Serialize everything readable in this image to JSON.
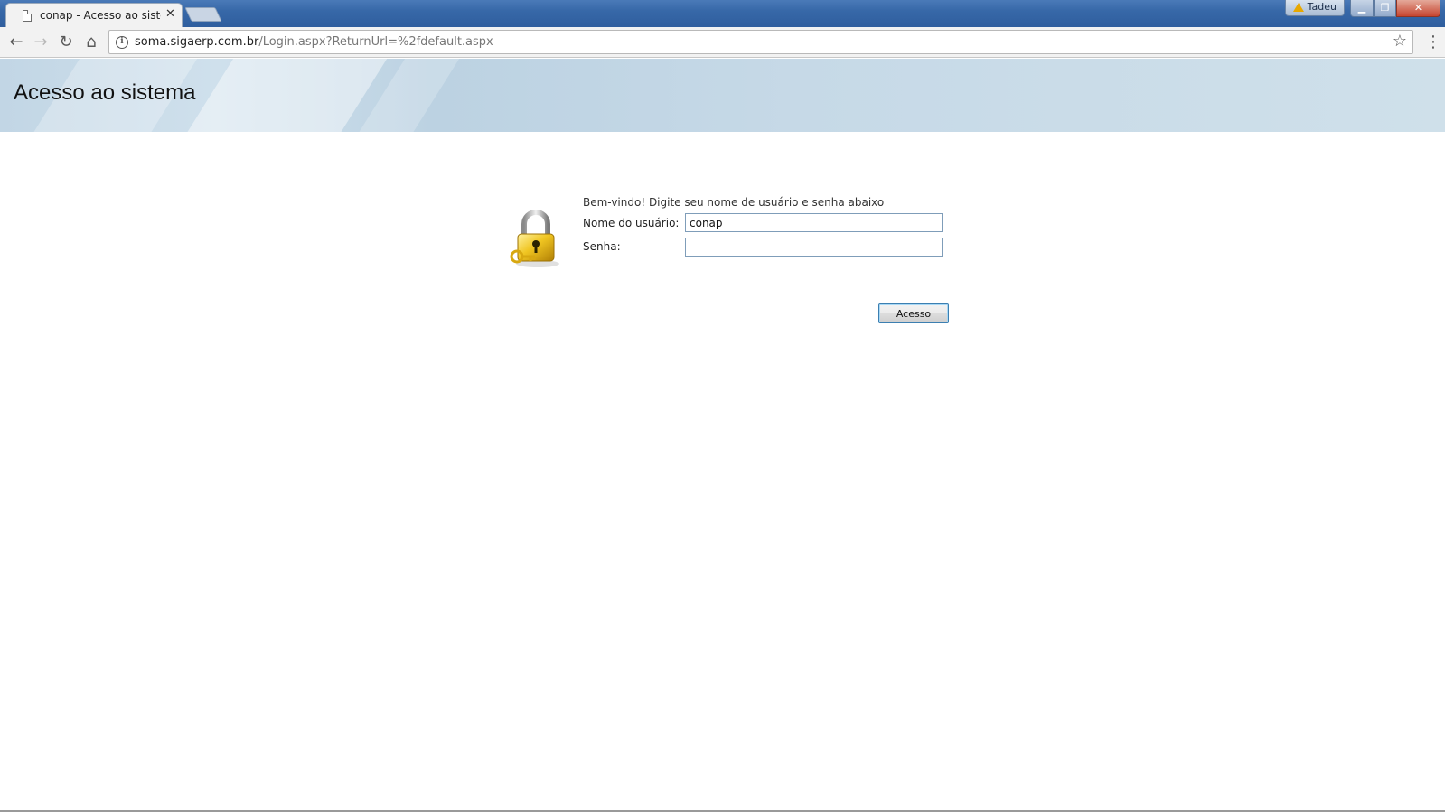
{
  "browser": {
    "tab": {
      "title": "conap - Acesso ao sistema",
      "close_glyph": "✕"
    },
    "profile": {
      "name": "Tadeu"
    },
    "window_controls": {
      "minimize": "▁",
      "maximize": "❐",
      "close": "✕"
    },
    "nav": {
      "back": "←",
      "forward": "→",
      "reload": "↻",
      "home": "⌂",
      "info": "i",
      "bookmark": "☆",
      "menu": "⋮"
    },
    "url": {
      "host": "soma.sigaerp.com.br",
      "path": "/Login.aspx?ReturnUrl=%2fdefault.aspx"
    }
  },
  "page": {
    "title": "Acesso ao sistema"
  },
  "login": {
    "welcome": "Bem-vindo! Digite seu nome de usuário e senha abaixo",
    "username_label": "Nome do usuário:",
    "username_value": "conap",
    "password_label": "Senha:",
    "password_value": "",
    "submit_label": "Acesso",
    "lock_icon": "padlock-with-key-icon"
  },
  "colors": {
    "header_band": "#c6d9e7",
    "button_border": "#3c7fb1",
    "titlebar": "#3768a8"
  }
}
